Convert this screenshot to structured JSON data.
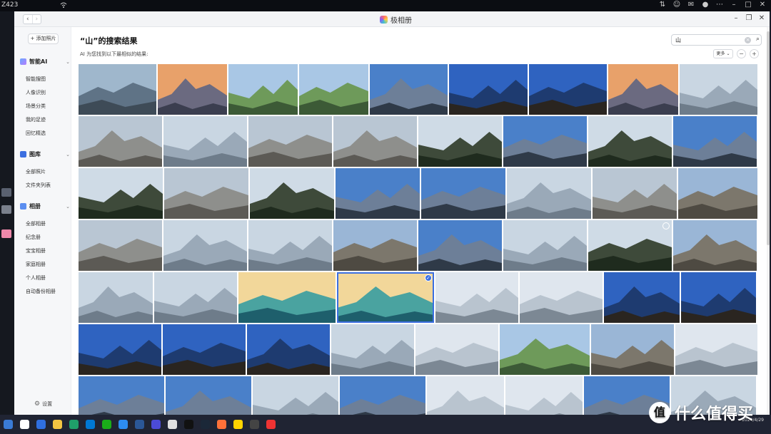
{
  "desktop": {
    "top_label": "Z423",
    "tray_date": "2024/4/29"
  },
  "window": {
    "app_title": "极相册"
  },
  "sidebar": {
    "add_photo_label": "+ 添加照片",
    "sections": [
      {
        "label": "智能AI",
        "items": [
          "智能搜图",
          "人像识别",
          "场景分类",
          "我的足迹",
          "回忆精选"
        ]
      },
      {
        "label": "图库",
        "items": [
          "全部照片",
          "文件夹列表"
        ]
      },
      {
        "label": "相册",
        "items": [
          "全部相册",
          "纪念册",
          "宝宝相册",
          "家庭相册",
          "个人相册",
          "自动备份相册"
        ]
      }
    ],
    "settings_label": "设置"
  },
  "main": {
    "title": "“山”的搜索结果",
    "subtitle": "AI 为您找到以下最相似的结果:",
    "search": {
      "value": "山"
    },
    "more_label": "更多",
    "zoom_out_label": "−",
    "zoom_in_label": "+"
  },
  "colors": {
    "accent": "#3c6fe0"
  },
  "icons": [
    "back-icon",
    "forward-icon",
    "search-icon",
    "clear-icon",
    "gear-icon",
    "minimize-icon",
    "maximize-icon",
    "close-icon",
    "check-icon"
  ],
  "watermark": "值 什么值得买"
}
